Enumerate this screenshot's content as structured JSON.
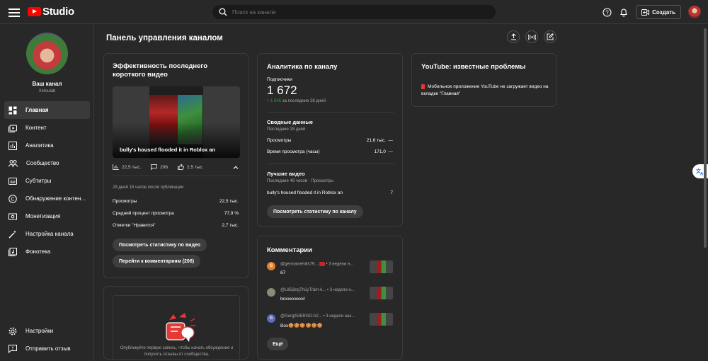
{
  "header": {
    "logo_text": "Studio",
    "search_placeholder": "Поиск на канале",
    "create_label": "Создать"
  },
  "sidebar": {
    "channel_title": "Ваш канал",
    "channel_handle": "Xetoulab",
    "items": [
      {
        "label": "Главная",
        "icon": "dashboard-icon",
        "active": true
      },
      {
        "label": "Контент",
        "icon": "content-icon"
      },
      {
        "label": "Аналитика",
        "icon": "analytics-icon"
      },
      {
        "label": "Сообщество",
        "icon": "community-icon"
      },
      {
        "label": "Субтитры",
        "icon": "subtitles-icon"
      },
      {
        "label": "Обнаружение контен...",
        "icon": "copyright-icon"
      },
      {
        "label": "Монетизация",
        "icon": "monetization-icon"
      },
      {
        "label": "Настройка канала",
        "icon": "customization-icon"
      },
      {
        "label": "Фонотека",
        "icon": "audio-library-icon"
      }
    ],
    "bottom": [
      {
        "label": "Настройки",
        "icon": "gear-icon"
      },
      {
        "label": "Отправить отзыв",
        "icon": "feedback-icon"
      }
    ]
  },
  "page": {
    "title": "Панель управления каналом"
  },
  "latest_short": {
    "title": "Эффективность последнего короткого видео",
    "video_title": "bully's housed flooded it in Roblox an",
    "views": "22,5 тыс.",
    "comments": "206",
    "likes": "2,5 тыс.",
    "since": "29 дней 15 часов после публикации",
    "rows": [
      {
        "label": "Просмотры",
        "value": "22,5 тыс."
      },
      {
        "label": "Средний процент просмотра",
        "value": "77,9 %"
      },
      {
        "label": "Отметки \"Нравится\"",
        "value": "2,7 тыс."
      }
    ],
    "btn_stats": "Посмотреть статистику по видео",
    "btn_comments": "Перейти к комментариям (206)"
  },
  "analytics": {
    "title": "Аналитика по каналу",
    "subs_label": "Подписчики",
    "subs_value": "1 672",
    "subs_growth": "+ 1 645",
    "subs_growth_period": "за последние 28 дней",
    "summary_title": "Сводные данные",
    "summary_period": "Последние 28 дней",
    "summary_rows": [
      {
        "label": "Просмотры",
        "value": "21,6 тыс.",
        "trend": "—"
      },
      {
        "label": "Время просмотра (часы)",
        "value": "171,0",
        "trend": "—"
      }
    ],
    "top_title": "Лучшие видео",
    "top_period": "Последние 48 часов · Просмотры",
    "top_video": {
      "title": "bully's housed flooded it in Roblox an",
      "views": "7"
    },
    "btn_stats": "Посмотреть статистику по каналу"
  },
  "comments": {
    "title": "Комментарии",
    "items": [
      {
        "initial": "G",
        "avatar_color": "#e67e22",
        "author": "@germainehills79...",
        "time": "• 3 недели н...",
        "text": "67"
      },
      {
        "initial": "",
        "avatar_color": "#8a8a7a",
        "author": "@LêĐặngThùyTrâm-k...",
        "time": "• 3 недели н...",
        "text": "boxxxxxxxx!"
      },
      {
        "initial": "G",
        "avatar_color": "#5c6bc0",
        "author": "@GergőGERGO-h2...",
        "time": "• 3 недели наз...",
        "text": "Box🍪🍪🍪🍪🍪🍪"
      }
    ],
    "more_label": "Ещё"
  },
  "issues": {
    "title": "YouTube: известные проблемы",
    "text": "Мобильное приложение YouTube не загружает видео на вкладке \"Главная\""
  },
  "community": {
    "text": "Опубликуйте первую запись, чтобы начать обсуждение и получить отзывы от сообщества."
  }
}
